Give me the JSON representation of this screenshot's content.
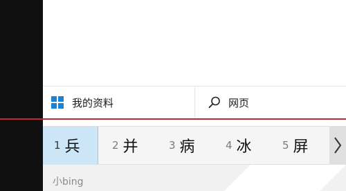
{
  "start_panel": {
    "tabs": {
      "mystuff": {
        "icon": "windows-logo-icon",
        "label": "我的资料"
      },
      "web": {
        "icon": "search-icon",
        "label": "网页"
      }
    }
  },
  "ime": {
    "candidates": [
      {
        "index": "1",
        "char": "兵"
      },
      {
        "index": "2",
        "char": "并"
      },
      {
        "index": "3",
        "char": "病"
      },
      {
        "index": "4",
        "char": "冰"
      },
      {
        "index": "5",
        "char": "屏"
      }
    ],
    "next_icon": "chevron-right-icon",
    "hint": "小bing"
  },
  "colors": {
    "accent_blue": "#1e82d2",
    "selected_candidate_bg": "#cde6f7",
    "red_line": "#c4282c",
    "left_strip": "#101010"
  }
}
